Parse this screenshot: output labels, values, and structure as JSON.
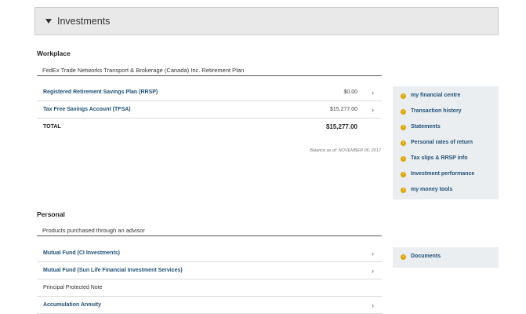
{
  "header": {
    "title": "Investments"
  },
  "workplace": {
    "title": "Workplace",
    "plan_name": "FedEx Trade Networks Transport & Brokerage (Canada) Inc. Retirement Plan",
    "rows": [
      {
        "label": "Registered Retirement Savings Plan (RRSP)",
        "amount": "$0.00"
      },
      {
        "label": "Tax Free Savings Account (TFSA)",
        "amount": "$15,277.00"
      }
    ],
    "total_label": "TOTAL",
    "total_amount": "$15,277.00",
    "balance_note": "Balance as of: NOVEMBER 06, 2017"
  },
  "workplace_sidebar": {
    "items": [
      "my financial centre",
      "Transaction history",
      "Statements",
      "Personal rates of return",
      "Tax slips & RRSP info",
      "Investment performance",
      "my money tools"
    ]
  },
  "personal": {
    "title": "Personal",
    "subhead": "Products purchased through an advisor",
    "rows": [
      {
        "label": "Mutual Fund (CI Investments)",
        "link": true
      },
      {
        "label": "Mutual Fund (Sun Life Financial Investment Services)",
        "link": true
      },
      {
        "label": "Principal Protected Note",
        "link": false
      },
      {
        "label": "Accumulation Annuity",
        "link": true
      }
    ]
  },
  "personal_sidebar": {
    "items": [
      "Documents"
    ]
  },
  "colors": {
    "link": "#1f5077",
    "accent": "#e2a400",
    "sidebar_bg": "#eaeef0"
  },
  "icons": {
    "chevron": "chevron-right-icon",
    "bullet": "arrow-circle-icon",
    "caret": "caret-down-icon"
  }
}
